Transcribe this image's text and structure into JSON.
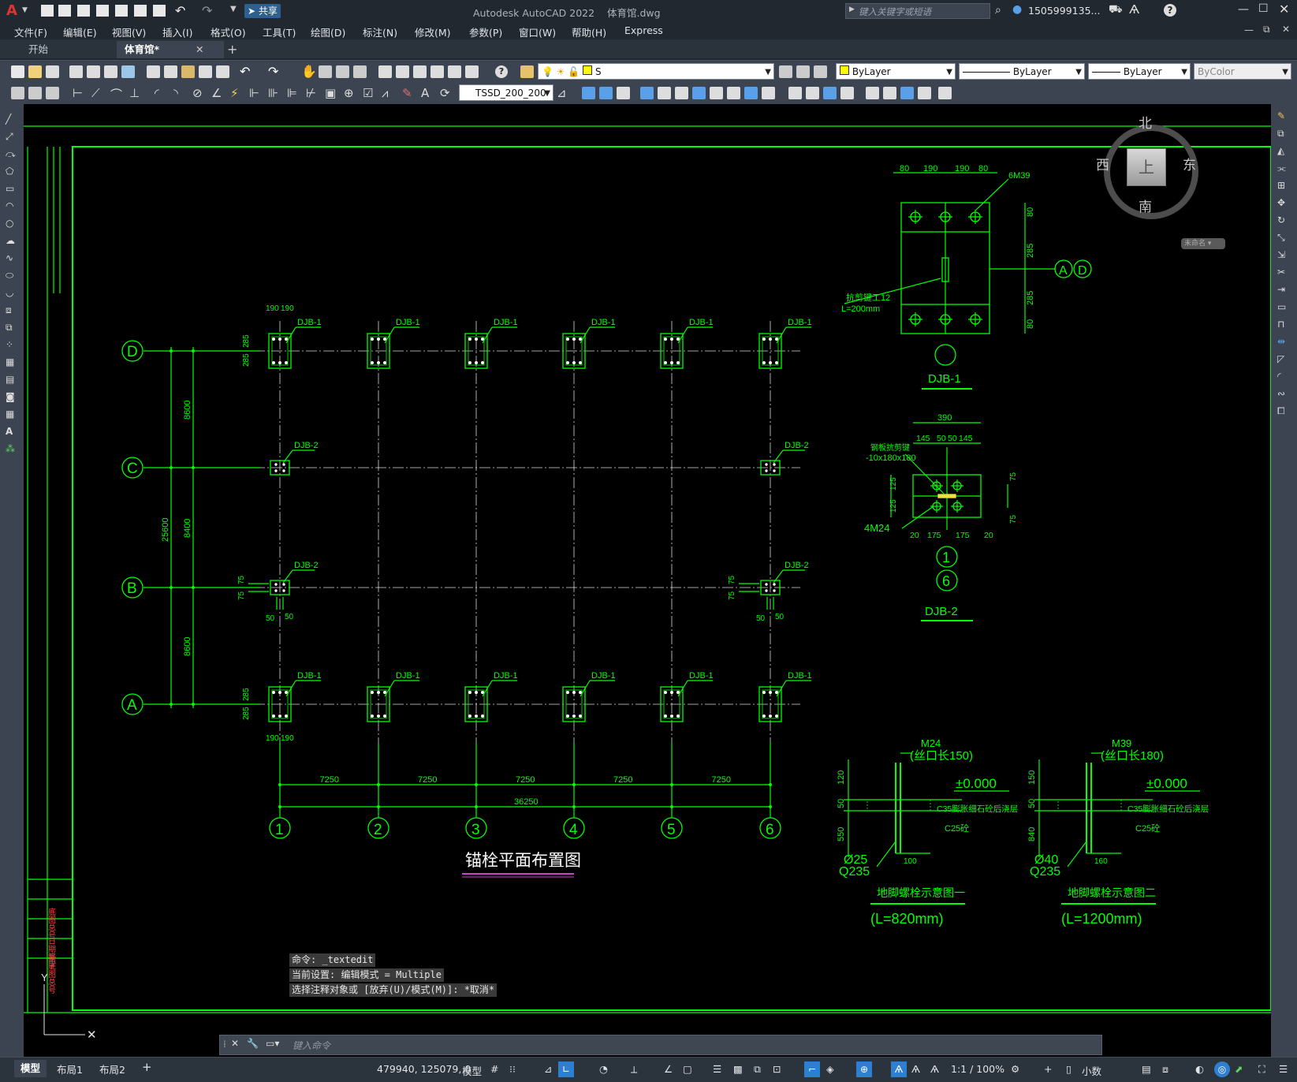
{
  "app": {
    "window_title": "Autodesk AutoCAD 2022    体育馆.dwg",
    "search_placeholder": "键入关键字或短语",
    "user": "1505999135...",
    "share_label": "共享"
  },
  "menu": [
    "文件(F)",
    "编辑(E)",
    "视图(V)",
    "插入(I)",
    "格式(O)",
    "工具(T)",
    "绘图(D)",
    "标注(N)",
    "修改(M)",
    "参数(P)",
    "窗口(W)",
    "帮助(H)",
    "Express"
  ],
  "tabs": [
    {
      "label": "开始",
      "active": false
    },
    {
      "label": "体育馆*",
      "active": true
    }
  ],
  "toolbar": {
    "layer_name": "S",
    "color": "ByLayer",
    "linetype": "ByLayer",
    "lineweight": "ByLayer",
    "plotstyle": "ByColor",
    "dimstyle": "TSSD_200_200"
  },
  "viewcube": {
    "north": "北",
    "south": "南",
    "east": "东",
    "west": "西",
    "face": "上",
    "ucs_label": "未命名"
  },
  "drawing": {
    "plan_title": "锚栓平面布置图",
    "grid_rows": [
      "D",
      "C",
      "B",
      "A"
    ],
    "grid_cols": [
      "1",
      "2",
      "3",
      "4",
      "5",
      "6"
    ],
    "col_spacing": "7250",
    "total_width": "36250",
    "row_spacing_top": "8600",
    "row_spacing_mid": "8400",
    "row_spacing_bot": "8600",
    "total_height": "25600",
    "djb1": "DJB-1",
    "djb2": "DJB-2",
    "dim_190": "190",
    "dim_285": "285",
    "dim_75": "75",
    "dim_50": "50",
    "detail1": {
      "title": "DJB-1",
      "top_dims": [
        "80",
        "190",
        "190",
        "80"
      ],
      "bolt_label": "6M39",
      "side_dims": [
        "80",
        "285",
        "285",
        "80"
      ],
      "shear_key": "抗剪键工12",
      "shear_len": "L=200mm",
      "axis_a": "A",
      "axis_d": "D"
    },
    "detail2": {
      "title": "DJB-2",
      "top_total": "390",
      "top_dims": [
        "145",
        "50",
        "50",
        "145"
      ],
      "key_label": "钢板抗剪键",
      "key_size": "-10x180x180",
      "bolt_label": "4M24",
      "left_dims": [
        "125",
        "125"
      ],
      "right_dims": [
        "75",
        "75"
      ],
      "bottom_dims": [
        "20",
        "175",
        "175",
        "20"
      ],
      "axis_1": "1",
      "axis_6": "6"
    },
    "anchor1": {
      "bolt": "M24",
      "thread": "(丝口长150)",
      "elev": "±0.000",
      "grout": "C35膨胀细石砼后浇层",
      "concrete": "C25砼",
      "dims": [
        "120",
        "50",
        "550"
      ],
      "dia": "Ø25",
      "steel": "Q235",
      "hook": "100",
      "title": "地脚螺栓示意图一",
      "length": "(L=820mm)"
    },
    "anchor2": {
      "bolt": "M39",
      "thread": "(丝口长180)",
      "elev": "±0.000",
      "grout": "C35膨胀细石砼后浇层",
      "concrete": "C25砼",
      "dims": [
        "150",
        "50",
        "840"
      ],
      "dia": "Ø40",
      "steel": "Q235",
      "hook": "160",
      "title": "地脚螺栓示意图二",
      "length": "(L=1200mm)"
    },
    "title_block": [
      "新底图总号",
      "底图总号",
      "日期签字"
    ]
  },
  "command": {
    "history": [
      "命令: _textedit",
      "当前设置: 编辑模式 = Multiple",
      "选择注释对象或 [放弃(U)/模式(M)]: *取消*"
    ],
    "placeholder": "键入命令"
  },
  "layout_tabs": [
    "模型",
    "布局1",
    "布局2"
  ],
  "status": {
    "coords": "479940, 125079, 0",
    "space": "模型",
    "scale": "1:1 / 100%",
    "units": "小数"
  },
  "colors": {
    "cad_green": "#00ff00",
    "background": "#000000",
    "ui_dark": "#212830",
    "ui_toolbar": "#3b4450",
    "accent_red": "#e03232"
  }
}
